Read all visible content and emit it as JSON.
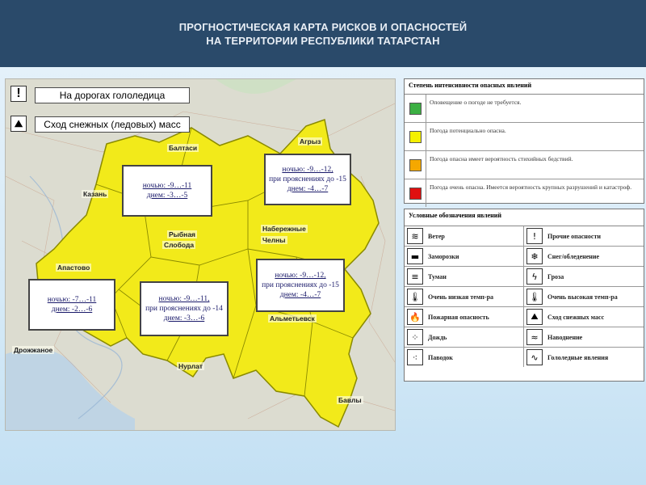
{
  "header": {
    "line1": "ПРОГНОСТИЧЕСКАЯ КАРТА РИСКОВ И ОПАСНОСТЕЙ",
    "line2": "НА ТЕРРИТОРИИ РЕСПУБЛИКИ ТАТАРСТАН"
  },
  "map": {
    "warnings": [
      {
        "icon": "!",
        "icon_name": "exclamation-icon",
        "label": "На дорогах гололедица"
      },
      {
        "icon": "⛰",
        "icon_name": "avalanche-icon",
        "label": "Сход снежных (ледовых) масс"
      }
    ],
    "cities": {
      "baltasi": "Балтаси",
      "kazan": "Казань",
      "aznakaevo_top": "Агрыз",
      "rybnaya": "Рыбная",
      "sloboda": "Слобода",
      "naberezhnye": "Набережные",
      "chelny": "Челны",
      "apastovo": "Апастово",
      "almetyevsk": "Альметьевск",
      "drozhzhanoe": "Дрожжаное",
      "nurlat": "Нурлат",
      "bavly": "Бавлы"
    },
    "temps": [
      {
        "night": "ночью: -9…-11",
        "day": "днем: -3…-5",
        "extra": ""
      },
      {
        "night": "ночью: -9…-12,",
        "extra": "при прояснениях до -15",
        "day": "днем: -4…-7"
      },
      {
        "night": "ночью: -7…-11",
        "day": "днем: -2…-6",
        "extra": ""
      },
      {
        "night": "ночью: -9…-11,",
        "extra": "при прояснениях до -14",
        "day": "днем: -3…-6"
      },
      {
        "night": "ночью: -9…-12,",
        "extra": "при прояснениях до -15",
        "day": "днем: -4…-7"
      }
    ]
  },
  "legend_levels": {
    "title": "Степень интенсивности опасных явлений",
    "rows": [
      {
        "color": "#3cb043",
        "text": "Оповещение о погоде не требуется."
      },
      {
        "color": "#f5f000",
        "text": "Погода потенциально опасна."
      },
      {
        "color": "#f5a800",
        "text": "Погода опасна имеет вероятность стихийных бедствий."
      },
      {
        "color": "#e01010",
        "text": "Погода очень опасна. Имеется вероятность крупных разрушений и катастроф."
      }
    ]
  },
  "legend_symbols": {
    "title": "Условные обозначения явлений",
    "items": [
      {
        "icon": "≋",
        "icon_name": "wind-icon",
        "label": "Ветер"
      },
      {
        "icon": "!",
        "icon_name": "other-hazards-icon",
        "label": "Прочие опасности"
      },
      {
        "icon": "▬",
        "icon_name": "frost-icon",
        "label": "Заморозки"
      },
      {
        "icon": "❄",
        "icon_name": "snow-icing-icon",
        "label": "Снег/обледенение"
      },
      {
        "icon": "≡",
        "icon_name": "fog-icon",
        "label": "Туман"
      },
      {
        "icon": "ϟ",
        "icon_name": "thunderstorm-icon",
        "label": "Гроза"
      },
      {
        "icon": "🌡",
        "icon_name": "low-temp-icon",
        "label": "Очень низкая темп-ра"
      },
      {
        "icon": "🌡",
        "icon_name": "high-temp-icon",
        "label": "Очень высокая темп-ра"
      },
      {
        "icon": "🔥",
        "icon_name": "fire-danger-icon",
        "label": "Пожарная опасность"
      },
      {
        "icon": "⛰",
        "icon_name": "avalanche-icon",
        "label": "Сход снежных масс"
      },
      {
        "icon": "⁘",
        "icon_name": "rain-icon",
        "label": "Дождь"
      },
      {
        "icon": "≈",
        "icon_name": "flood-icon",
        "label": "Наводнение"
      },
      {
        "icon": "⁖",
        "icon_name": "flood-rain-icon",
        "label": "Паводок"
      },
      {
        "icon": "∿",
        "icon_name": "ice-phenomena-icon",
        "label": "Гололедные явления"
      }
    ]
  }
}
